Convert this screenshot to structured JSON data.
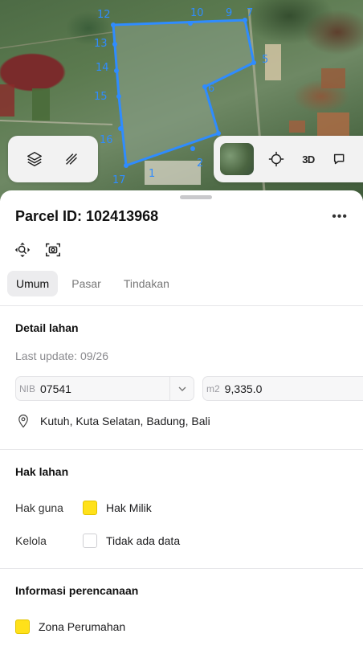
{
  "map": {
    "vertex_labels": [
      "1",
      "2",
      "6",
      "9",
      "10",
      "12",
      "13",
      "14",
      "15",
      "16",
      "17",
      "5",
      "7"
    ],
    "boundary_color": "#2f8cff",
    "controls": {
      "layers_icon": "layers-icon",
      "draw_icon": "draw-icon",
      "locate_icon": "crosshair-icon",
      "three_d_label": "3D",
      "extra_icon": "chat-icon"
    }
  },
  "sheet": {
    "title": "Parcel ID: 102413968",
    "more_label": "•••",
    "tabs": [
      {
        "label": "Umum",
        "active": true
      },
      {
        "label": "Pasar",
        "active": false
      },
      {
        "label": "Tindakan",
        "active": false
      }
    ],
    "detail": {
      "heading": "Detail lahan",
      "last_update": "Last update: 09/26",
      "nib_label": "NIB",
      "nib_value": "07541",
      "area_label": "m2",
      "area_value": "9,335.0",
      "location": "Kutuh, Kuta Selatan, Badung, Bali"
    },
    "rights": {
      "heading": "Hak lahan",
      "rows": [
        {
          "key": "Hak guna",
          "value": "Hak Milik",
          "swatch": "#ffe11a"
        },
        {
          "key": "Kelola",
          "value": "Tidak ada data",
          "swatch": "#ffffff"
        }
      ]
    },
    "planning": {
      "heading": "Informasi perencanaan",
      "zone": "Zona Perumahan",
      "zone_color": "#ffe11a"
    }
  }
}
